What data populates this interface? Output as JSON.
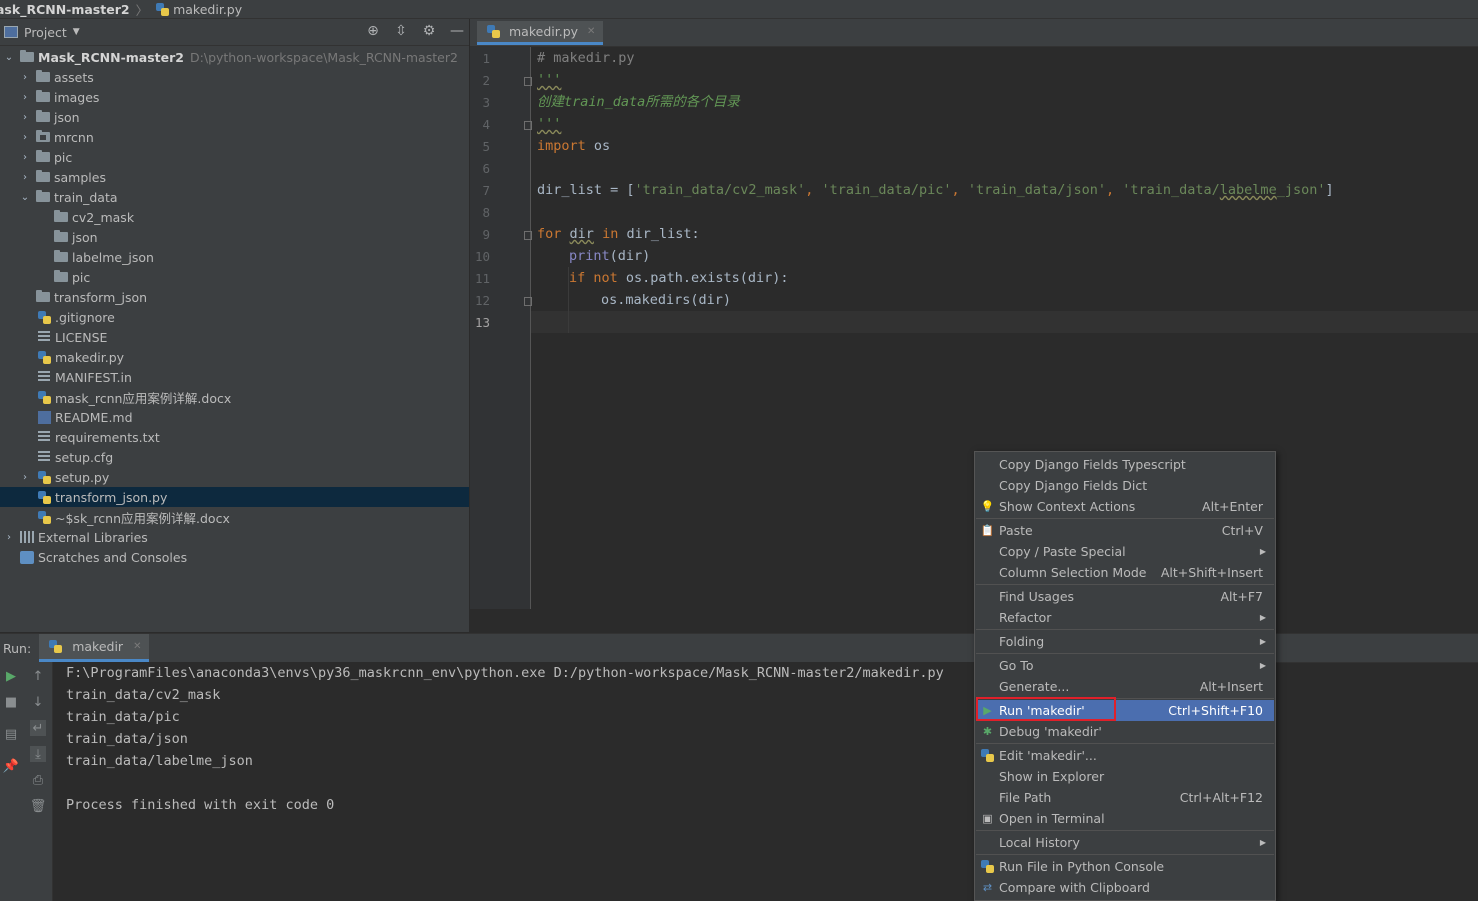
{
  "breadcrumb": {
    "root": "ask_RCNN-master2",
    "file": "makedir.py"
  },
  "project_panel": {
    "title": "Project",
    "tree": [
      {
        "label": "Mask_RCNN-master2",
        "hint": "D:\\python-workspace\\Mask_RCNN-master2"
      },
      {
        "label": "assets"
      },
      {
        "label": "images"
      },
      {
        "label": "json"
      },
      {
        "label": "mrcnn"
      },
      {
        "label": "pic"
      },
      {
        "label": "samples"
      },
      {
        "label": "train_data"
      },
      {
        "label": "cv2_mask"
      },
      {
        "label": "json"
      },
      {
        "label": "labelme_json"
      },
      {
        "label": "pic"
      },
      {
        "label": "transform_json"
      },
      {
        "label": ".gitignore"
      },
      {
        "label": "LICENSE"
      },
      {
        "label": "makedir.py"
      },
      {
        "label": "MANIFEST.in"
      },
      {
        "label": "mask_rcnn应用案例详解.docx"
      },
      {
        "label": "README.md"
      },
      {
        "label": "requirements.txt"
      },
      {
        "label": "setup.cfg"
      },
      {
        "label": "setup.py"
      },
      {
        "label": "transform_json.py"
      },
      {
        "label": "~$sk_rcnn应用案例详解.docx"
      },
      {
        "label": "External Libraries"
      },
      {
        "label": "Scratches and Consoles"
      }
    ]
  },
  "editor": {
    "tab": "makedir.py",
    "line_numbers": [
      "1",
      "2",
      "3",
      "4",
      "5",
      "6",
      "7",
      "8",
      "9",
      "10",
      "11",
      "12",
      "13"
    ],
    "code": {
      "l1": "# makedir.py",
      "l2": "'''",
      "l3a": "创建",
      "l3b": "train_data",
      "l3c": "所需的各个目录",
      "l4": "'''",
      "l5_kw": "import",
      "l5_rest": " os",
      "l7_a": "dir_list = [",
      "l7_s1": "'train_data/cv2_mask'",
      "l7_s2": "'train_data/pic'",
      "l7_s3": "'train_data/json'",
      "l7_s4a": "'train_data/",
      "l7_s4b": "labelme",
      "l7_s4c": "_json'",
      "l7_comma": ", ",
      "l7_end": "]",
      "l9_for": "for",
      "l9_dir": "dir",
      "l9_in": "in",
      "l9_rest": " dir_list:",
      "l10_print": "print",
      "l10_rest": "(dir)",
      "l11_if": "if",
      "l11_not": "not",
      "l11_rest": " os.path.exists(dir):",
      "l12": "os.makedirs(dir)"
    }
  },
  "run_panel": {
    "label": "Run:",
    "tab": "makedir",
    "output": [
      "F:\\ProgramFiles\\anaconda3\\envs\\py36_maskrcnn_env\\python.exe D:/python-workspace/Mask_RCNN-master2/makedir.py",
      "train_data/cv2_mask",
      "train_data/pic",
      "train_data/json",
      "train_data/labelme_json",
      "",
      "Process finished with exit code 0"
    ]
  },
  "context_menu": {
    "items": [
      {
        "label": "Copy Django Fields Typescript",
        "shortcut": ""
      },
      {
        "label": "Copy Django Fields Dict",
        "shortcut": ""
      },
      {
        "label": "Show Context Actions",
        "shortcut": "Alt+Enter"
      },
      {
        "label": "Paste",
        "shortcut": "Ctrl+V"
      },
      {
        "label": "Copy / Paste Special",
        "shortcut": ""
      },
      {
        "label": "Column Selection Mode",
        "shortcut": "Alt+Shift+Insert"
      },
      {
        "label": "Find Usages",
        "shortcut": "Alt+F7"
      },
      {
        "label": "Refactor",
        "shortcut": ""
      },
      {
        "label": "Folding",
        "shortcut": ""
      },
      {
        "label": "Go To",
        "shortcut": ""
      },
      {
        "label": "Generate...",
        "shortcut": "Alt+Insert"
      },
      {
        "label": "Run 'makedir'",
        "shortcut": "Ctrl+Shift+F10"
      },
      {
        "label": "Debug 'makedir'",
        "shortcut": ""
      },
      {
        "label": "Edit 'makedir'...",
        "shortcut": ""
      },
      {
        "label": "Show in Explorer",
        "shortcut": ""
      },
      {
        "label": "File Path",
        "shortcut": "Ctrl+Alt+F12"
      },
      {
        "label": "Open in Terminal",
        "shortcut": ""
      },
      {
        "label": "Local History",
        "shortcut": ""
      },
      {
        "label": "Run File in Python Console",
        "shortcut": ""
      },
      {
        "label": "Compare with Clipboard",
        "shortcut": ""
      }
    ]
  },
  "colors": {
    "keyword": "#cc7832",
    "string": "#6a8759",
    "comment": "#808080",
    "highlight": "#4b6eaf",
    "selection": "#0d293e",
    "annotation_box": "#e0202a"
  }
}
